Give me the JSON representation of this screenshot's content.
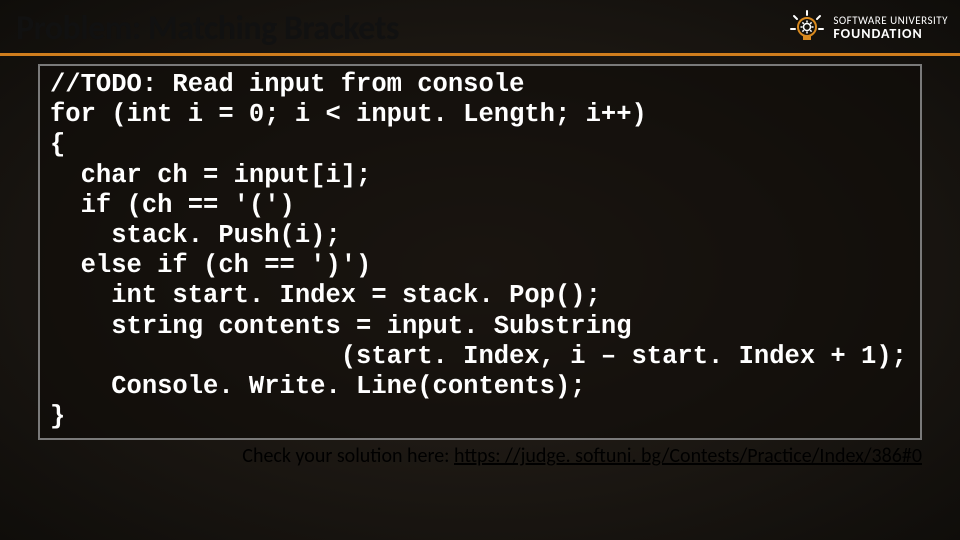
{
  "header": {
    "title": "Problem: Matching Brackets",
    "logo": {
      "line1": "SOFTWARE UNIVERSITY",
      "line2": "FOUNDATION"
    }
  },
  "code": {
    "lines": [
      "//TODO: Read input from console",
      "for (int i = 0; i < input. Length; i++)",
      "{",
      "  char ch = input[i];",
      "  if (ch == '(')",
      "    stack. Push(i);",
      "  else if (ch == ')')",
      "    int start. Index = stack. Pop();",
      "    string contents = input. Substring",
      "                   (start. Index, i – start. Index + 1);",
      "    Console. Write. Line(contents);",
      "}"
    ]
  },
  "footer": {
    "prefix": "Check your solution here: ",
    "link_text": "https: //judge. softuni. bg/Contests/Practice/Index/386#0",
    "link_href": "https://judge.softuni.bg/Contests/Practice/Index/386#0"
  }
}
